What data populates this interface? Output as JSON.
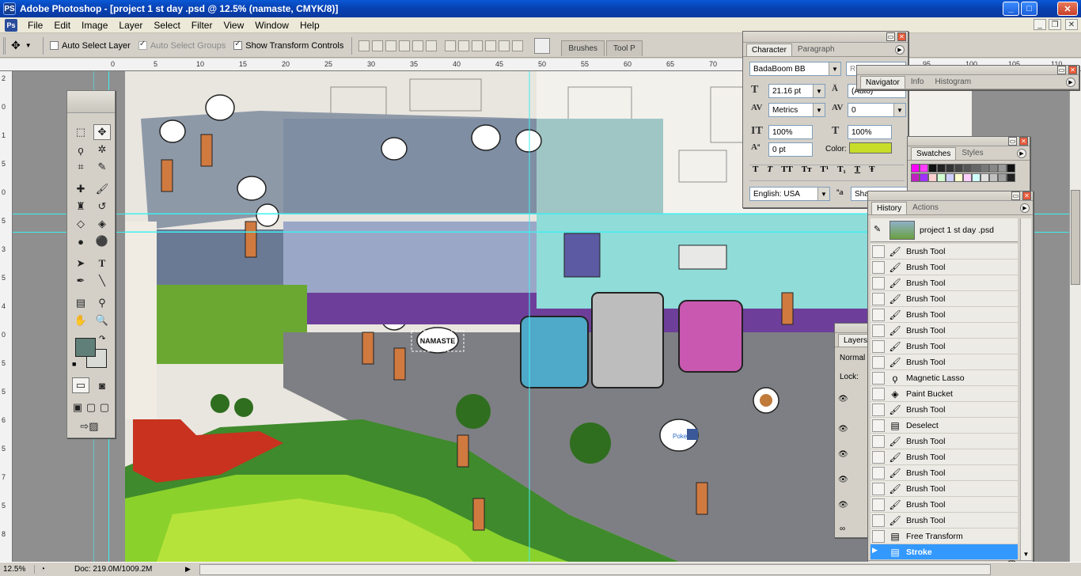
{
  "window": {
    "title": "Adobe Photoshop - [project 1 st day .psd @ 12.5% (namaste, CMYK/8)]",
    "app_icon": "PS",
    "controls": [
      "_",
      "□",
      "✕"
    ]
  },
  "menu": {
    "items": [
      "File",
      "Edit",
      "Image",
      "Layer",
      "Select",
      "Filter",
      "View",
      "Window",
      "Help"
    ]
  },
  "options": {
    "auto_select_layer": {
      "label": "Auto Select Layer",
      "checked": false
    },
    "auto_select_groups": {
      "label": "Auto Select Groups",
      "checked": false,
      "disabled": true
    },
    "show_transform_controls": {
      "label": "Show Transform Controls",
      "checked": true
    },
    "well_tabs": [
      "Brushes",
      "Tool P"
    ]
  },
  "ruler": {
    "top_ticks": [
      "0",
      "5",
      "10",
      "15",
      "20",
      "25",
      "30",
      "35",
      "40",
      "45",
      "50",
      "55",
      "60",
      "65",
      "70",
      "75",
      "80",
      "85",
      "90",
      "95",
      "100",
      "105",
      "110"
    ],
    "left_ticks": [
      "2",
      "0",
      "1",
      "5",
      "0",
      "5",
      "3",
      "5",
      "4",
      "0",
      "5",
      "5",
      "6",
      "5",
      "7",
      "5",
      "8"
    ]
  },
  "status": {
    "zoom": "12.5%",
    "doc": "Doc: 219.0M/1009.2M"
  },
  "character": {
    "tabs": [
      "Character",
      "Paragraph"
    ],
    "font_family": "BadaBoom BB",
    "font_style": "R",
    "font_size": "21.16 pt",
    "leading": "(Auto)",
    "kerning": "Metrics",
    "tracking": "0",
    "vertical_scale": "100%",
    "horizontal_scale": "100%",
    "baseline_shift": "0 pt",
    "color_label": "Color:",
    "color": "#c8dd2a",
    "language": "English: USA",
    "antialias": "Sha",
    "style_buttons": [
      "T",
      "T",
      "TT",
      "Tт",
      "T¹",
      "T₁",
      "T",
      "Ŧ"
    ]
  },
  "navigator": {
    "tabs": [
      "Navigator",
      "Info",
      "Histogram"
    ]
  },
  "swatches": {
    "tabs": [
      "Swatches",
      "Styles"
    ]
  },
  "layers": {
    "tab": "Layers",
    "blend_mode": "Normal",
    "lock_label": "Lock:"
  },
  "history": {
    "tabs": [
      "History",
      "Actions"
    ],
    "snapshot": "project 1 st day .psd",
    "states": [
      {
        "label": "Brush Tool",
        "icon": "brush-icon"
      },
      {
        "label": "Brush Tool",
        "icon": "brush-icon"
      },
      {
        "label": "Brush Tool",
        "icon": "brush-icon"
      },
      {
        "label": "Brush Tool",
        "icon": "brush-icon"
      },
      {
        "label": "Brush Tool",
        "icon": "brush-icon"
      },
      {
        "label": "Brush Tool",
        "icon": "brush-icon"
      },
      {
        "label": "Brush Tool",
        "icon": "brush-icon"
      },
      {
        "label": "Brush Tool",
        "icon": "brush-icon"
      },
      {
        "label": "Magnetic Lasso",
        "icon": "magnetic-lasso-icon"
      },
      {
        "label": "Paint Bucket",
        "icon": "paint-bucket-icon"
      },
      {
        "label": "Brush Tool",
        "icon": "brush-icon"
      },
      {
        "label": "Deselect",
        "icon": "document-icon"
      },
      {
        "label": "Brush Tool",
        "icon": "brush-icon"
      },
      {
        "label": "Brush Tool",
        "icon": "brush-icon"
      },
      {
        "label": "Brush Tool",
        "icon": "brush-icon"
      },
      {
        "label": "Brush Tool",
        "icon": "brush-icon"
      },
      {
        "label": "Brush Tool",
        "icon": "brush-icon"
      },
      {
        "label": "Brush Tool",
        "icon": "brush-icon"
      },
      {
        "label": "Free Transform",
        "icon": "document-icon"
      },
      {
        "label": "Stroke",
        "icon": "document-icon",
        "selected": true
      }
    ]
  },
  "canvas_text": {
    "speech_bubble": "NAMASTE",
    "logo_text": "Poke"
  },
  "colors": {
    "foreground": "#5f7f78",
    "background": "#d9dcd6",
    "history_selection": "#3399ff"
  }
}
